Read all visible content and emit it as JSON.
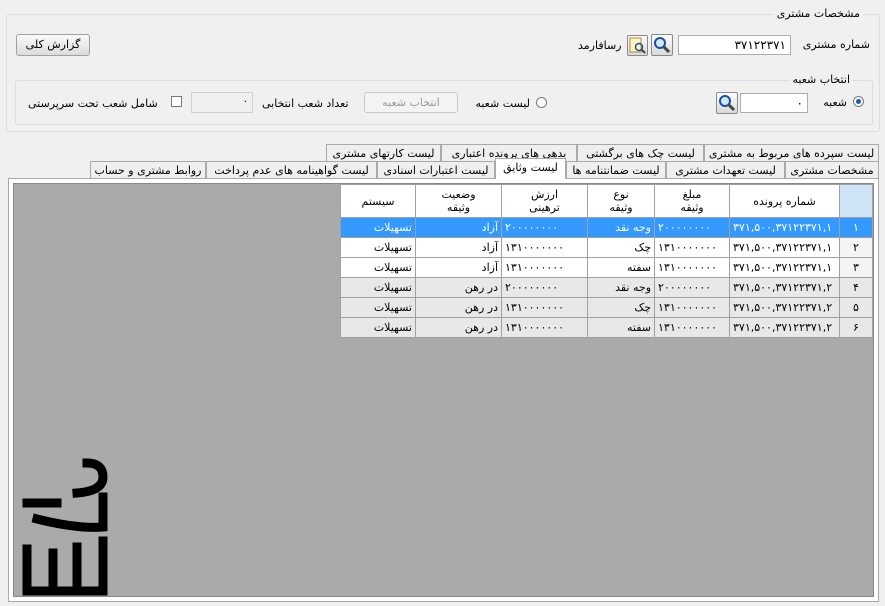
{
  "customer_section": {
    "title": "مشخصات مشتری",
    "customer_number_label": "شماره مشتری",
    "customer_number_value": "۳۷۱۲۲۳۷۱",
    "rasafarmad_label": "رسافارمد",
    "full_report_label": "گزارش کلی"
  },
  "branch_section": {
    "title": "انتخاب شعبه",
    "branch_radio_label": "شعبه",
    "branch_value": "۰",
    "branch_list_radio_label": "لیست شعبه",
    "select_branch_button": "انتخاب شعبه",
    "selected_branches_count_label": "تعداد شعب انتخابی",
    "selected_branches_count_value": "۰",
    "include_supervised_label": "شامل شعب تحت سرپرستی"
  },
  "tabs_row1": [
    {
      "label": "لیست سپرده های مربوط به مشتری"
    },
    {
      "label": "لیست چک های برگشتی"
    },
    {
      "label": "بدهی های پرونده اعتباری"
    },
    {
      "label": "لیست کارتهای مشتری"
    }
  ],
  "tabs_row2": [
    {
      "label": "مشخصات مشتری"
    },
    {
      "label": "لیست تعهدات مشتری"
    },
    {
      "label": "لیست ضمانتنامه ها"
    },
    {
      "label": "لیست وثایق"
    },
    {
      "label": "لیست اعتبارات اسنادی"
    },
    {
      "label": "لیست گواهینامه های عدم پرداخت"
    },
    {
      "label": "روابط مشتری و حساب"
    }
  ],
  "active_tab": "لیست وثایق",
  "table": {
    "headers": [
      "شماره پرونده",
      "مبلغ\nوثیقه",
      "نوع\nوثیقه",
      "ارزش\nترهینی",
      "وضعیت\nوثیقه",
      "سیستم"
    ],
    "rows": [
      {
        "idx": "۱",
        "file": "۳۷۱,۵۰۰,۳۷۱۲۲۳۷۱,۱",
        "amount": "۲۰۰۰۰۰۰۰۰",
        "type": "وجه نقد",
        "value": "۲۰۰۰۰۰۰۰۰",
        "status": "آزاد",
        "system": "تسهیلات"
      },
      {
        "idx": "۲",
        "file": "۳۷۱,۵۰۰,۳۷۱۲۲۳۷۱,۱",
        "amount": "۱۳۱۰۰۰۰۰۰۰",
        "type": "چک",
        "value": "۱۳۱۰۰۰۰۰۰۰",
        "status": "آزاد",
        "system": "تسهیلات"
      },
      {
        "idx": "۳",
        "file": "۳۷۱,۵۰۰,۳۷۱۲۲۳۷۱,۱",
        "amount": "۱۳۱۰۰۰۰۰۰۰",
        "type": "سفته",
        "value": "۱۳۱۰۰۰۰۰۰۰",
        "status": "آزاد",
        "system": "تسهیلات"
      },
      {
        "idx": "۴",
        "file": "۳۷۱,۵۰۰,۳۷۱۲۲۳۷۱,۲",
        "amount": "۲۰۰۰۰۰۰۰۰",
        "type": "وجه نقد",
        "value": "۲۰۰۰۰۰۰۰۰",
        "status": "در رهن",
        "system": "تسهیلات"
      },
      {
        "idx": "۵",
        "file": "۳۷۱,۵۰۰,۳۷۱۲۲۳۷۱,۲",
        "amount": "۱۳۱۰۰۰۰۰۰۰",
        "type": "چک",
        "value": "۱۳۱۰۰۰۰۰۰۰",
        "status": "در رهن",
        "system": "تسهیلات"
      },
      {
        "idx": "۶",
        "file": "۳۷۱,۵۰۰,۳۷۱۲۲۳۷۱,۲",
        "amount": "۱۳۱۰۰۰۰۰۰۰",
        "type": "سفته",
        "value": "۱۳۱۰۰۰۰۰۰۰",
        "status": "در رهن",
        "system": "تسهیلات"
      }
    ],
    "selected_row": 0
  },
  "colors": {
    "selection": "#3399ff",
    "grid_background": "#aaaaaa"
  },
  "icons": {
    "search": "search-icon",
    "report": "document-search-icon"
  }
}
